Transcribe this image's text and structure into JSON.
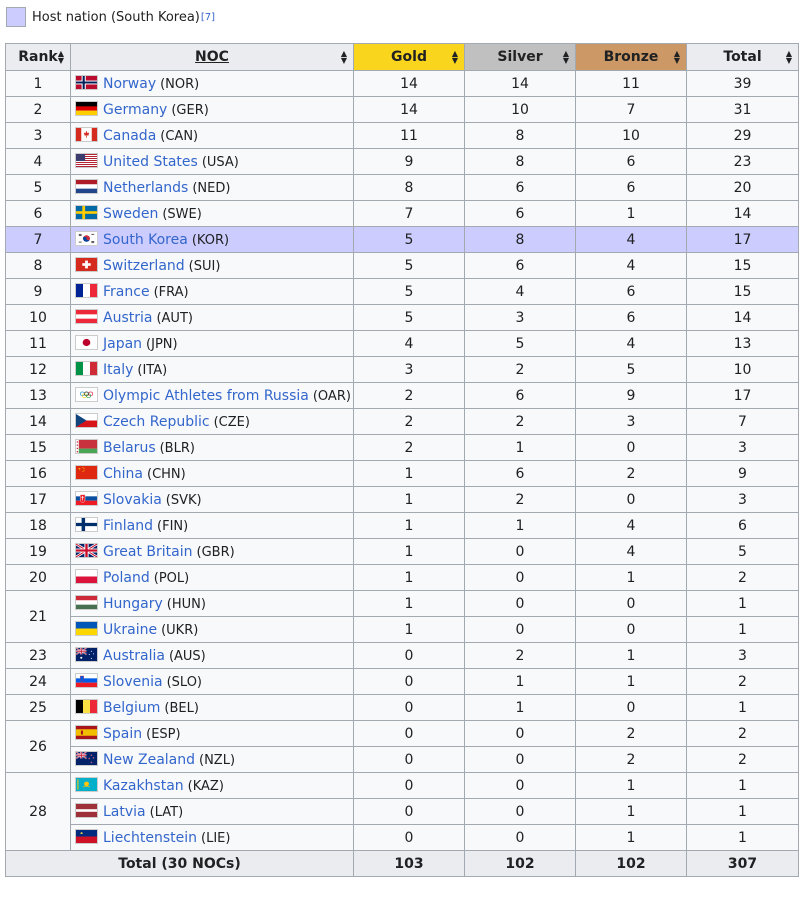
{
  "legend": {
    "text": "Host nation (South Korea)",
    "ref": "[7]",
    "host_color": "#ccccff"
  },
  "header": {
    "rank": "Rank",
    "noc": "NOC",
    "gold": "Gold",
    "silver": "Silver",
    "bronze": "Bronze",
    "total": "Total"
  },
  "colors": {
    "gold": "#fad51d",
    "silver": "#c0c0c0",
    "bronze": "#cc9966",
    "link": "#3366cc",
    "host": "#ccccff"
  },
  "rows": [
    {
      "rank": "1",
      "country": "Norway",
      "code": "(NOR)",
      "flag": "norway-flag-icon",
      "gold": "14",
      "silver": "14",
      "bronze": "11",
      "total": "39"
    },
    {
      "rank": "2",
      "country": "Germany",
      "code": "(GER)",
      "flag": "germany-flag-icon",
      "gold": "14",
      "silver": "10",
      "bronze": "7",
      "total": "31"
    },
    {
      "rank": "3",
      "country": "Canada",
      "code": "(CAN)",
      "flag": "canada-flag-icon",
      "gold": "11",
      "silver": "8",
      "bronze": "10",
      "total": "29"
    },
    {
      "rank": "4",
      "country": "United States",
      "code": "(USA)",
      "flag": "usa-flag-icon",
      "gold": "9",
      "silver": "8",
      "bronze": "6",
      "total": "23"
    },
    {
      "rank": "5",
      "country": "Netherlands",
      "code": "(NED)",
      "flag": "netherlands-flag-icon",
      "gold": "8",
      "silver": "6",
      "bronze": "6",
      "total": "20"
    },
    {
      "rank": "6",
      "country": "Sweden",
      "code": "(SWE)",
      "flag": "sweden-flag-icon",
      "gold": "7",
      "silver": "6",
      "bronze": "1",
      "total": "14"
    },
    {
      "rank": "7",
      "country": "South Korea",
      "code": "(KOR)",
      "flag": "south-korea-flag-icon",
      "gold": "5",
      "silver": "8",
      "bronze": "4",
      "total": "17",
      "host": true
    },
    {
      "rank": "8",
      "country": "Switzerland",
      "code": "(SUI)",
      "flag": "switzerland-flag-icon",
      "gold": "5",
      "silver": "6",
      "bronze": "4",
      "total": "15"
    },
    {
      "rank": "9",
      "country": "France",
      "code": "(FRA)",
      "flag": "france-flag-icon",
      "gold": "5",
      "silver": "4",
      "bronze": "6",
      "total": "15"
    },
    {
      "rank": "10",
      "country": "Austria",
      "code": "(AUT)",
      "flag": "austria-flag-icon",
      "gold": "5",
      "silver": "3",
      "bronze": "6",
      "total": "14"
    },
    {
      "rank": "11",
      "country": "Japan",
      "code": "(JPN)",
      "flag": "japan-flag-icon",
      "gold": "4",
      "silver": "5",
      "bronze": "4",
      "total": "13"
    },
    {
      "rank": "12",
      "country": "Italy",
      "code": "(ITA)",
      "flag": "italy-flag-icon",
      "gold": "3",
      "silver": "2",
      "bronze": "5",
      "total": "10"
    },
    {
      "rank": "13",
      "country": "Olympic Athletes from Russia",
      "code": "(OAR)",
      "flag": "olympic-rings-flag-icon",
      "gold": "2",
      "silver": "6",
      "bronze": "9",
      "total": "17"
    },
    {
      "rank": "14",
      "country": "Czech Republic",
      "code": "(CZE)",
      "flag": "czech-flag-icon",
      "gold": "2",
      "silver": "2",
      "bronze": "3",
      "total": "7"
    },
    {
      "rank": "15",
      "country": "Belarus",
      "code": "(BLR)",
      "flag": "belarus-flag-icon",
      "gold": "2",
      "silver": "1",
      "bronze": "0",
      "total": "3"
    },
    {
      "rank": "16",
      "country": "China",
      "code": "(CHN)",
      "flag": "china-flag-icon",
      "gold": "1",
      "silver": "6",
      "bronze": "2",
      "total": "9"
    },
    {
      "rank": "17",
      "country": "Slovakia",
      "code": "(SVK)",
      "flag": "slovakia-flag-icon",
      "gold": "1",
      "silver": "2",
      "bronze": "0",
      "total": "3"
    },
    {
      "rank": "18",
      "country": "Finland",
      "code": "(FIN)",
      "flag": "finland-flag-icon",
      "gold": "1",
      "silver": "1",
      "bronze": "4",
      "total": "6"
    },
    {
      "rank": "19",
      "country": "Great Britain",
      "code": "(GBR)",
      "flag": "great-britain-flag-icon",
      "gold": "1",
      "silver": "0",
      "bronze": "4",
      "total": "5"
    },
    {
      "rank": "20",
      "country": "Poland",
      "code": "(POL)",
      "flag": "poland-flag-icon",
      "gold": "1",
      "silver": "0",
      "bronze": "1",
      "total": "2"
    },
    {
      "rank": "21",
      "rankspan": 2,
      "country": "Hungary",
      "code": "(HUN)",
      "flag": "hungary-flag-icon",
      "gold": "1",
      "silver": "0",
      "bronze": "0",
      "total": "1"
    },
    {
      "country": "Ukraine",
      "code": "(UKR)",
      "flag": "ukraine-flag-icon",
      "gold": "1",
      "silver": "0",
      "bronze": "0",
      "total": "1"
    },
    {
      "rank": "23",
      "country": "Australia",
      "code": "(AUS)",
      "flag": "australia-flag-icon",
      "gold": "0",
      "silver": "2",
      "bronze": "1",
      "total": "3"
    },
    {
      "rank": "24",
      "country": "Slovenia",
      "code": "(SLO)",
      "flag": "slovenia-flag-icon",
      "gold": "0",
      "silver": "1",
      "bronze": "1",
      "total": "2"
    },
    {
      "rank": "25",
      "country": "Belgium",
      "code": "(BEL)",
      "flag": "belgium-flag-icon",
      "gold": "0",
      "silver": "1",
      "bronze": "0",
      "total": "1"
    },
    {
      "rank": "26",
      "rankspan": 2,
      "country": "Spain",
      "code": "(ESP)",
      "flag": "spain-flag-icon",
      "gold": "0",
      "silver": "0",
      "bronze": "2",
      "total": "2"
    },
    {
      "country": "New Zealand",
      "code": "(NZL)",
      "flag": "new-zealand-flag-icon",
      "gold": "0",
      "silver": "0",
      "bronze": "2",
      "total": "2"
    },
    {
      "rank": "28",
      "rankspan": 3,
      "country": "Kazakhstan",
      "code": "(KAZ)",
      "flag": "kazakhstan-flag-icon",
      "gold": "0",
      "silver": "0",
      "bronze": "1",
      "total": "1"
    },
    {
      "country": "Latvia",
      "code": "(LAT)",
      "flag": "latvia-flag-icon",
      "gold": "0",
      "silver": "0",
      "bronze": "1",
      "total": "1"
    },
    {
      "country": "Liechtenstein",
      "code": "(LIE)",
      "flag": "liechtenstein-flag-icon",
      "gold": "0",
      "silver": "0",
      "bronze": "1",
      "total": "1"
    }
  ],
  "totals": {
    "label": "Total (30 NOCs)",
    "gold": "103",
    "silver": "102",
    "bronze": "102",
    "total": "307"
  }
}
